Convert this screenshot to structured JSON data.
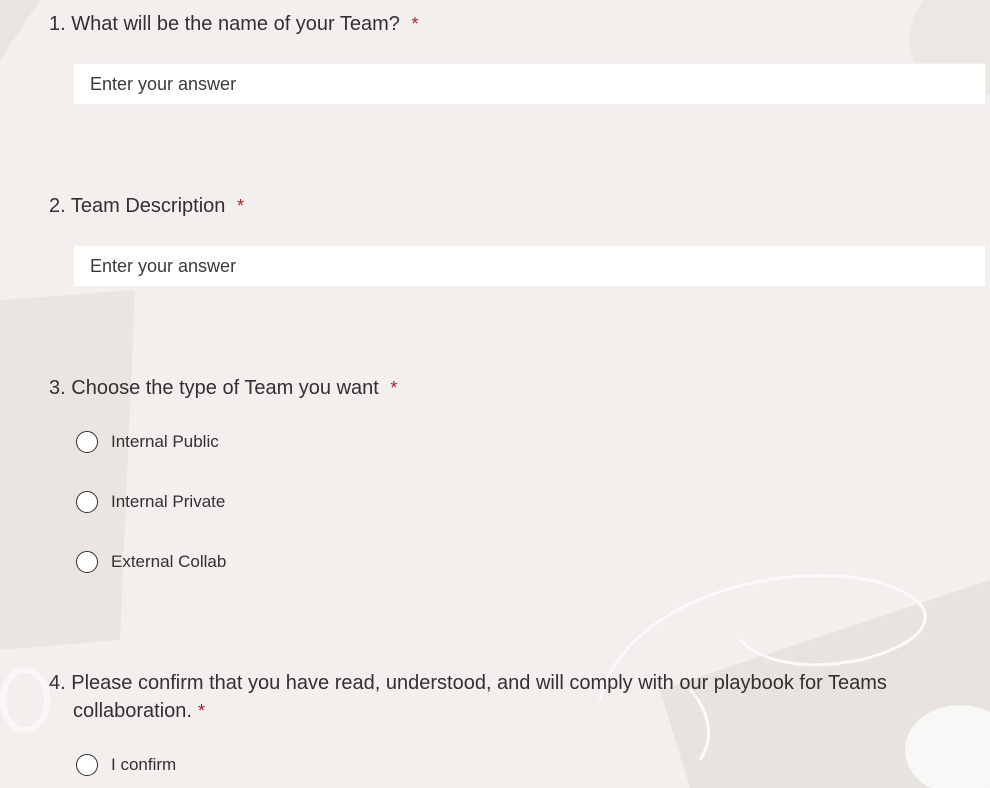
{
  "questions": [
    {
      "number": "1.",
      "text": "What will be the name of your Team?",
      "required_mark": "*",
      "placeholder": "Enter your answer"
    },
    {
      "number": "2.",
      "text": "Team Description",
      "required_mark": "*",
      "placeholder": "Enter your answer"
    },
    {
      "number": "3.",
      "text": "Choose the type of Team you want",
      "required_mark": "*",
      "options": [
        "Internal Public",
        "Internal Private",
        "External Collab"
      ]
    },
    {
      "number": "4.",
      "text": "Please confirm that you have read, understood, and will comply with our playbook for Teams collaboration.",
      "required_mark": "*",
      "options": [
        "I confirm"
      ]
    }
  ],
  "colors": {
    "background": "#f2efec",
    "required": "#a4262c",
    "text": "#323130"
  }
}
